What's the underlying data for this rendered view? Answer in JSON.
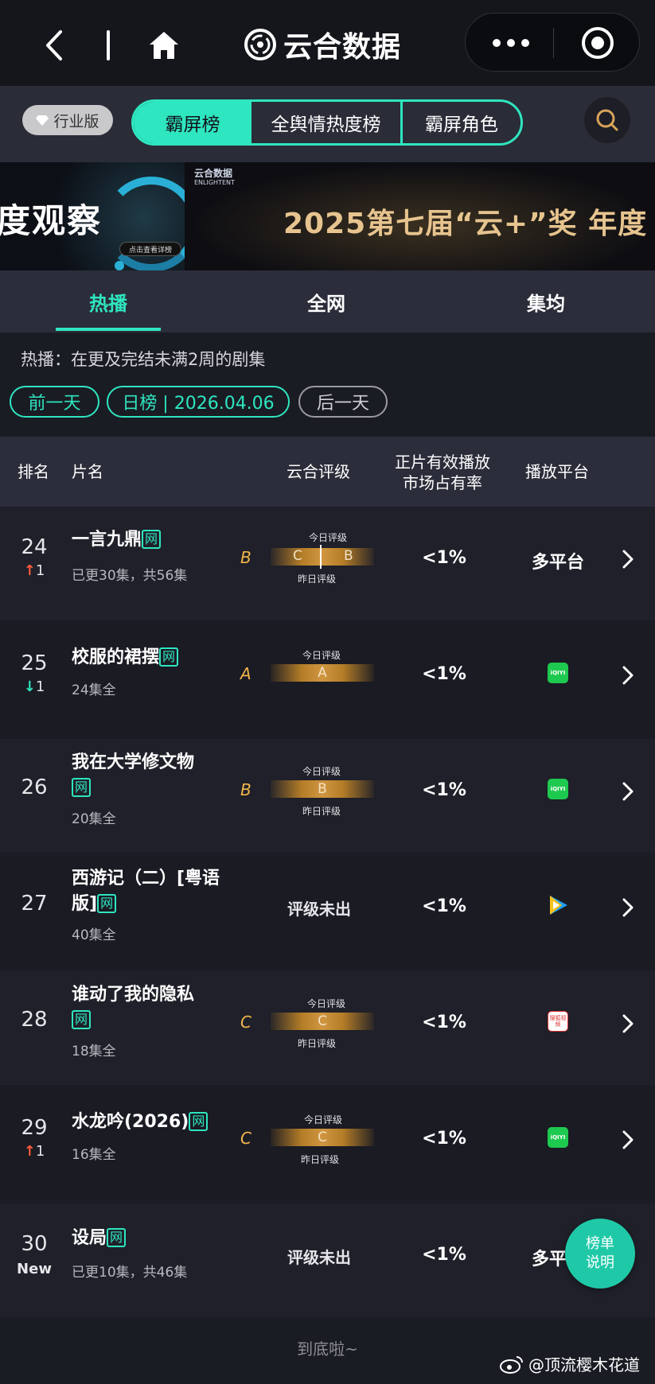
{
  "nav": {
    "brand": "云合数据"
  },
  "tabs": {
    "badge": "行业版",
    "items": [
      "霸屏榜",
      "全舆情热度榜",
      "霸屏角色"
    ]
  },
  "banner": {
    "left_text": "度观察",
    "left_pill": "点击查看详榜",
    "logo": "云合数据",
    "logo_en": "ENLIGHTENT",
    "title": "2025第七届“云+”奖 年度"
  },
  "subtabs": [
    "热播",
    "全网",
    "集均"
  ],
  "info": {
    "desc": "热播：在更及完结未满2周的剧集",
    "prev": "前一天",
    "date": "日榜 | 2026.04.06",
    "next": "后一天"
  },
  "table_header": {
    "rank": "排名",
    "title": "片名",
    "grade": "云合评级",
    "share_line1": "正片有效播放",
    "share_line2": "市场占有率",
    "platform": "播放平台"
  },
  "grade_labels": {
    "today": "今日评级",
    "yesterday": "昨日评级"
  },
  "rows": [
    {
      "rank": "24",
      "change_dir": "↑",
      "change_val": "1",
      "title": "一言九鼎",
      "tag": "网",
      "eps": "已更30集，共56集",
      "grade": "B",
      "bar_left": "C",
      "bar_right": "B",
      "share": "<1%",
      "platform": "多平台"
    },
    {
      "rank": "25",
      "change_dir": "↓",
      "change_val": "1",
      "title": "校服的裙摆",
      "tag": "网",
      "eps": "24集全",
      "grade": "A",
      "bar": "A",
      "share": "<1%",
      "platform_icon": "iqiyi-icon",
      "platform_icon_text": "iQIYI"
    },
    {
      "rank": "26",
      "title": "我在大学修文物",
      "tag": "网",
      "eps": "20集全",
      "grade": "B",
      "bar": "B",
      "share": "<1%",
      "platform_icon": "iqiyi-icon",
      "platform_icon_text": "iQIYI"
    },
    {
      "rank": "27",
      "title": "西游记（二）[粤语版]",
      "tag": "网",
      "eps": "40集全",
      "grade_text": "评级未出",
      "share": "<1%",
      "platform_icon": "tencent-video-icon"
    },
    {
      "rank": "28",
      "title": "谁动了我的隐私",
      "tag": "网",
      "eps": "18集全",
      "grade": "C",
      "bar": "C",
      "share": "<1%",
      "platform_icon": "sohu-video-icon",
      "platform_icon_text": "搜狐视频"
    },
    {
      "rank": "29",
      "change_dir": "↑",
      "change_val": "1",
      "title": "水龙吟(2026)",
      "tag": "网",
      "eps": "16集全",
      "grade": "C",
      "bar": "C",
      "share": "<1%",
      "platform_icon": "iqiyi-icon",
      "platform_icon_text": "iQIYI"
    },
    {
      "rank": "30",
      "change_text": "New",
      "title": "设局",
      "tag": "网",
      "eps": "已更10集，共46集",
      "grade_text": "评级未出",
      "share": "<1%",
      "platform": "多平台"
    }
  ],
  "footer": {
    "end": "到底啦~",
    "weibo": "@顶流樱木花道"
  },
  "float_button": {
    "line1": "榜单",
    "line2": "说明"
  },
  "colors": {
    "accent": "#2ee6c0",
    "up": "#ff5b3b",
    "grade": "#f0b44a",
    "bg": "#1a1c24"
  }
}
